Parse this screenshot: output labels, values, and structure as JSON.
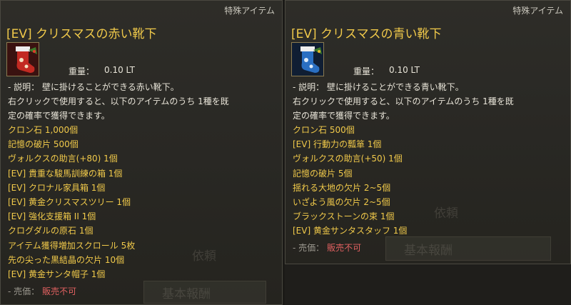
{
  "left": {
    "category": "特殊アイテム",
    "title": "[EV] クリスマスの赤い靴下",
    "icon": "red-christmas-stocking-icon",
    "weight_label": "重量：",
    "weight_value": "0.10 LT",
    "description_lines": [
      "- 説明：  壁に掛けることができる赤い靴下。",
      "右クリックで使用すると、以下のアイテムのうち 1種を既",
      "定の確率で獲得できます。"
    ],
    "items": [
      "クロン石 1,000個",
      "記憶の破片 500個",
      "ヴォルクスの助言(+80) 1個",
      "[EV] 貴重な駿馬訓練の箱 1個",
      "[EV] クロナル家具箱 1個",
      "[EV] 黄金クリスマスツリー 1個",
      "[EV] 強化支援箱 II 1個",
      "クログダルの原石 1個",
      "アイテム獲得増加スクロール 5枚",
      "先の尖った黒結晶の欠片 10個",
      "[EV] 黄金サンタ帽子 1個"
    ],
    "price_label": "- 売価：",
    "price_value": "販売不可",
    "bg_text_1": "依頼",
    "bg_text_2": "基本報酬"
  },
  "right": {
    "category": "特殊アイテム",
    "title": "[EV] クリスマスの青い靴下",
    "icon": "blue-christmas-stocking-icon",
    "weight_label": "重量：",
    "weight_value": "0.10 LT",
    "description_lines": [
      "- 説明：  壁に掛けることができる青い靴下。",
      "右クリックで使用すると、以下のアイテムのうち 1種を既",
      "定の確率で獲得できます。"
    ],
    "items": [
      "クロン石 500個",
      "[EV] 行動力の瓢箪 1個",
      "ヴォルクスの助言(+50) 1個",
      "記憶の破片 5個",
      "揺れる大地の欠片 2~5個",
      "いざよう風の欠片 2~5個",
      "ブラックストーンの束 1個",
      "[EV] 黄金サンタスタッフ 1個"
    ],
    "price_label": "- 売価：",
    "price_value": "販売不可",
    "bg_text_1": "依頼",
    "bg_text_2": "基本報酬"
  },
  "colors": {
    "title": "#f0c94a",
    "item": "#f0c94a",
    "text": "#e8e4d8",
    "price_value": "#e06060"
  }
}
